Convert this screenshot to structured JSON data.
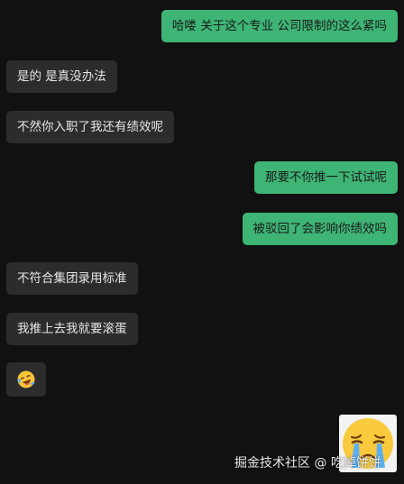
{
  "messages": [
    {
      "side": "out",
      "text": "哈喽  关于这个专业  公司限制的这么紧吗"
    },
    {
      "side": "in",
      "text": "是的 是真没办法"
    },
    {
      "side": "in",
      "text": "不然你入职了我还有绩效呢"
    },
    {
      "side": "out",
      "text": "那要不你推一下试试呢"
    },
    {
      "side": "out",
      "text": "被驳回了会影响你绩效吗"
    },
    {
      "side": "in",
      "text": "不符合集团录用标准"
    },
    {
      "side": "in",
      "text": "我推上去我就要滚蛋"
    }
  ],
  "emoji_message": {
    "icon": "laughing-crying-emoji-icon"
  },
  "sticker": {
    "icon": "crying-face-sticker-icon"
  },
  "watermark": "掘金技术社区 @ 吃掉饼饼",
  "colors": {
    "background": "#111111",
    "incoming_bubble": "#2c2c2c",
    "outgoing_bubble": "#3eb575"
  }
}
